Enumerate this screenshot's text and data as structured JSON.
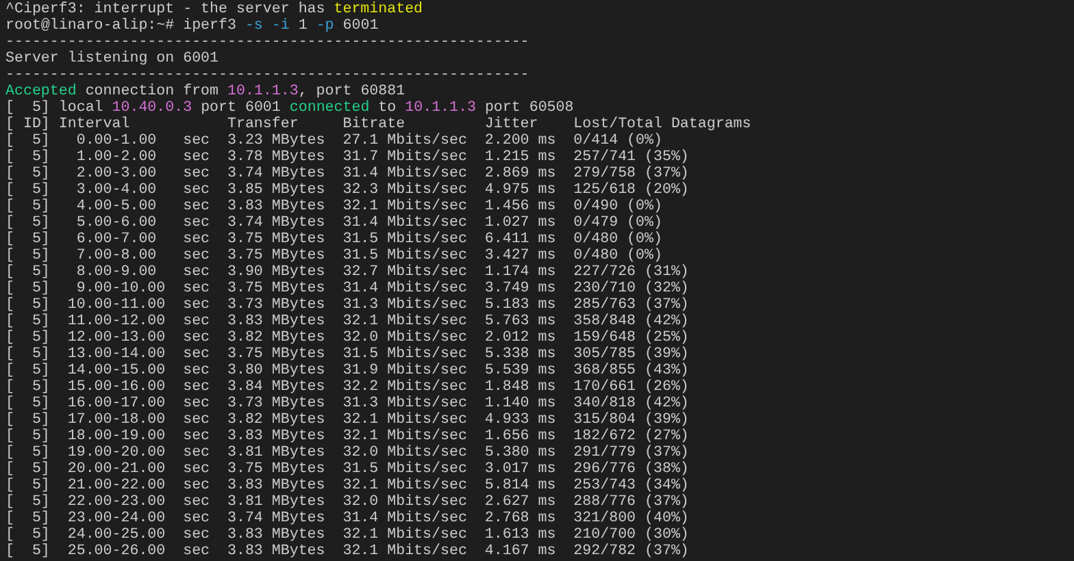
{
  "terminal": {
    "lines": [
      {
        "parts": [
          {
            "text": "^Ciperf3: interrupt - the server has ",
            "kind": "plain"
          },
          {
            "text": "terminated",
            "kind": "warning"
          }
        ]
      },
      {
        "parts": [
          {
            "text": "root@linaro-alip:~# iperf3 ",
            "kind": "plain"
          },
          {
            "text": "-s",
            "kind": "option"
          },
          {
            "text": " -i",
            "kind": "option"
          },
          {
            "text": " 1 ",
            "kind": "plain"
          },
          {
            "text": "-p",
            "kind": "option"
          },
          {
            "text": " 6001",
            "kind": "plain"
          }
        ]
      },
      {
        "parts": [
          {
            "text": "-----------------------------------------------------------",
            "kind": "plain"
          }
        ]
      },
      {
        "parts": [
          {
            "text": "Server listening on 6001",
            "kind": "plain"
          }
        ]
      },
      {
        "parts": [
          {
            "text": "-----------------------------------------------------------",
            "kind": "plain"
          }
        ]
      },
      {
        "parts": [
          {
            "text": "Accepted",
            "kind": "ok"
          },
          {
            "text": " connection from ",
            "kind": "plain"
          },
          {
            "text": "10.1.1.3",
            "kind": "address"
          },
          {
            "text": ", port 60881",
            "kind": "plain"
          }
        ]
      },
      {
        "parts": [
          {
            "text": "[  5] local ",
            "kind": "plain"
          },
          {
            "text": "10.40.0.3",
            "kind": "address"
          },
          {
            "text": " port 6001 ",
            "kind": "plain"
          },
          {
            "text": "connected",
            "kind": "ok"
          },
          {
            "text": " to ",
            "kind": "plain"
          },
          {
            "text": "10.1.1.3",
            "kind": "address"
          },
          {
            "text": " port 60508",
            "kind": "plain"
          }
        ]
      },
      {
        "parts": [
          {
            "text": "[ ID] Interval           Transfer     Bitrate         Jitter    Lost/Total Datagrams",
            "kind": "plain"
          }
        ]
      },
      {
        "parts": [
          {
            "text": "[  5]   0.00-1.00   sec  3.23 MBytes  27.1 Mbits/sec  2.200 ms  0/414 (0%)",
            "kind": "plain"
          }
        ]
      },
      {
        "parts": [
          {
            "text": "[  5]   1.00-2.00   sec  3.78 MBytes  31.7 Mbits/sec  1.215 ms  257/741 (35%)",
            "kind": "plain"
          }
        ]
      },
      {
        "parts": [
          {
            "text": "[  5]   2.00-3.00   sec  3.74 MBytes  31.4 Mbits/sec  2.869 ms  279/758 (37%)",
            "kind": "plain"
          }
        ]
      },
      {
        "parts": [
          {
            "text": "[  5]   3.00-4.00   sec  3.85 MBytes  32.3 Mbits/sec  4.975 ms  125/618 (20%)",
            "kind": "plain"
          }
        ]
      },
      {
        "parts": [
          {
            "text": "[  5]   4.00-5.00   sec  3.83 MBytes  32.1 Mbits/sec  1.456 ms  0/490 (0%)",
            "kind": "plain"
          }
        ]
      },
      {
        "parts": [
          {
            "text": "[  5]   5.00-6.00   sec  3.74 MBytes  31.4 Mbits/sec  1.027 ms  0/479 (0%)",
            "kind": "plain"
          }
        ]
      },
      {
        "parts": [
          {
            "text": "[  5]   6.00-7.00   sec  3.75 MBytes  31.5 Mbits/sec  6.411 ms  0/480 (0%)",
            "kind": "plain"
          }
        ]
      },
      {
        "parts": [
          {
            "text": "[  5]   7.00-8.00   sec  3.75 MBytes  31.5 Mbits/sec  3.427 ms  0/480 (0%)",
            "kind": "plain"
          }
        ]
      },
      {
        "parts": [
          {
            "text": "[  5]   8.00-9.00   sec  3.90 MBytes  32.7 Mbits/sec  1.174 ms  227/726 (31%)",
            "kind": "plain"
          }
        ]
      },
      {
        "parts": [
          {
            "text": "[  5]   9.00-10.00  sec  3.75 MBytes  31.4 Mbits/sec  3.749 ms  230/710 (32%)",
            "kind": "plain"
          }
        ]
      },
      {
        "parts": [
          {
            "text": "[  5]  10.00-11.00  sec  3.73 MBytes  31.3 Mbits/sec  5.183 ms  285/763 (37%)",
            "kind": "plain"
          }
        ]
      },
      {
        "parts": [
          {
            "text": "[  5]  11.00-12.00  sec  3.83 MBytes  32.1 Mbits/sec  5.763 ms  358/848 (42%)",
            "kind": "plain"
          }
        ]
      },
      {
        "parts": [
          {
            "text": "[  5]  12.00-13.00  sec  3.82 MBytes  32.0 Mbits/sec  2.012 ms  159/648 (25%)",
            "kind": "plain"
          }
        ]
      },
      {
        "parts": [
          {
            "text": "[  5]  13.00-14.00  sec  3.75 MBytes  31.5 Mbits/sec  5.338 ms  305/785 (39%)",
            "kind": "plain"
          }
        ]
      },
      {
        "parts": [
          {
            "text": "[  5]  14.00-15.00  sec  3.80 MBytes  31.9 Mbits/sec  5.539 ms  368/855 (43%)",
            "kind": "plain"
          }
        ]
      },
      {
        "parts": [
          {
            "text": "[  5]  15.00-16.00  sec  3.84 MBytes  32.2 Mbits/sec  1.848 ms  170/661 (26%)",
            "kind": "plain"
          }
        ]
      },
      {
        "parts": [
          {
            "text": "[  5]  16.00-17.00  sec  3.73 MBytes  31.3 Mbits/sec  1.140 ms  340/818 (42%)",
            "kind": "plain"
          }
        ]
      },
      {
        "parts": [
          {
            "text": "[  5]  17.00-18.00  sec  3.82 MBytes  32.1 Mbits/sec  4.933 ms  315/804 (39%)",
            "kind": "plain"
          }
        ]
      },
      {
        "parts": [
          {
            "text": "[  5]  18.00-19.00  sec  3.83 MBytes  32.1 Mbits/sec  1.656 ms  182/672 (27%)",
            "kind": "plain"
          }
        ]
      },
      {
        "parts": [
          {
            "text": "[  5]  19.00-20.00  sec  3.81 MBytes  32.0 Mbits/sec  5.380 ms  291/779 (37%)",
            "kind": "plain"
          }
        ]
      },
      {
        "parts": [
          {
            "text": "[  5]  20.00-21.00  sec  3.75 MBytes  31.5 Mbits/sec  3.017 ms  296/776 (38%)",
            "kind": "plain"
          }
        ]
      },
      {
        "parts": [
          {
            "text": "[  5]  21.00-22.00  sec  3.83 MBytes  32.1 Mbits/sec  5.814 ms  253/743 (34%)",
            "kind": "plain"
          }
        ]
      },
      {
        "parts": [
          {
            "text": "[  5]  22.00-23.00  sec  3.81 MBytes  32.0 Mbits/sec  2.627 ms  288/776 (37%)",
            "kind": "plain"
          }
        ]
      },
      {
        "parts": [
          {
            "text": "[  5]  23.00-24.00  sec  3.74 MBytes  31.4 Mbits/sec  2.768 ms  321/800 (40%)",
            "kind": "plain"
          }
        ]
      },
      {
        "parts": [
          {
            "text": "[  5]  24.00-25.00  sec  3.83 MBytes  32.1 Mbits/sec  1.613 ms  210/700 (30%)",
            "kind": "plain"
          }
        ]
      },
      {
        "parts": [
          {
            "text": "[  5]  25.00-26.00  sec  3.83 MBytes  32.1 Mbits/sec  4.167 ms  292/782 (37%)",
            "kind": "plain"
          }
        ]
      }
    ]
  }
}
